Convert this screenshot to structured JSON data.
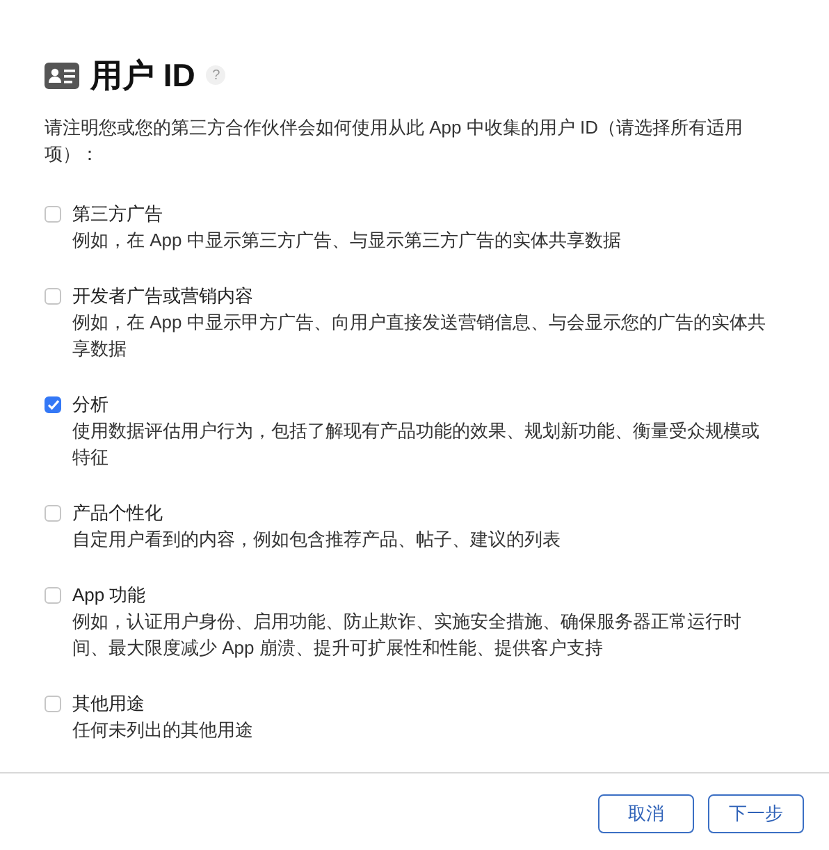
{
  "title": "用户 ID",
  "help": "?",
  "intro": "请注明您或您的第三方合作伙伴会如何使用从此 App 中收集的用户 ID（请选择所有适用项）：",
  "options": [
    {
      "label": "第三方广告",
      "description": "例如，在 App 中显示第三方广告、与显示第三方广告的实体共享数据",
      "checked": false
    },
    {
      "label": "开发者广告或营销内容",
      "description": "例如，在 App 中显示甲方广告、向用户直接发送营销信息、与会显示您的广告的实体共享数据",
      "checked": false
    },
    {
      "label": "分析",
      "description": "使用数据评估用户行为，包括了解现有产品功能的效果、规划新功能、衡量受众规模或特征",
      "checked": true
    },
    {
      "label": "产品个性化",
      "description": "自定用户看到的内容，例如包含推荐产品、帖子、建议的列表",
      "checked": false
    },
    {
      "label": "App 功能",
      "description": "例如，认证用户身份、启用功能、防止欺诈、实施安全措施、确保服务器正常运行时间、最大限度减少 App 崩溃、提升可扩展性和性能、提供客户支持",
      "checked": false
    },
    {
      "label": "其他用途",
      "description": "任何未列出的其他用途",
      "checked": false
    }
  ],
  "buttons": [
    "取消",
    "下一步"
  ]
}
